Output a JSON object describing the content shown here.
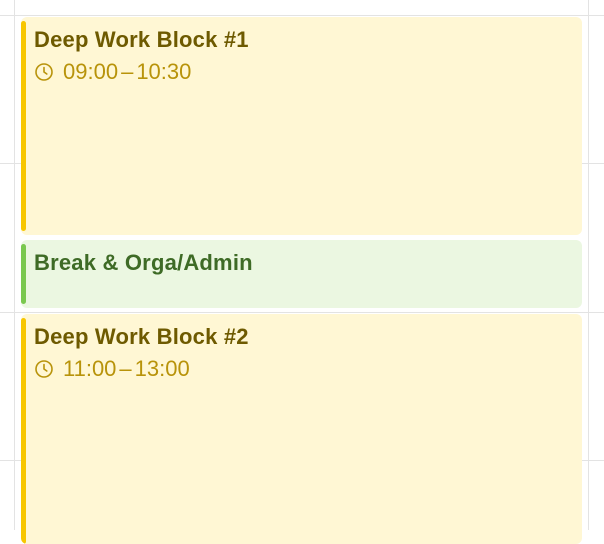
{
  "calendar": {
    "events": [
      {
        "title": "Deep Work Block #1",
        "start": "09:00",
        "end": "10:30",
        "separator": "–",
        "icon": "clock-icon",
        "color": "#f7c600",
        "background": "#fff7d4"
      },
      {
        "title": "Break & Orga/Admin",
        "icon": "none",
        "color": "#7ac84f",
        "background": "#ebf7e1"
      },
      {
        "title": "Deep Work Block #2",
        "start": "11:00",
        "end": "13:00",
        "separator": "–",
        "icon": "clock-icon",
        "color": "#f7c600",
        "background": "#fff7d4"
      }
    ]
  }
}
